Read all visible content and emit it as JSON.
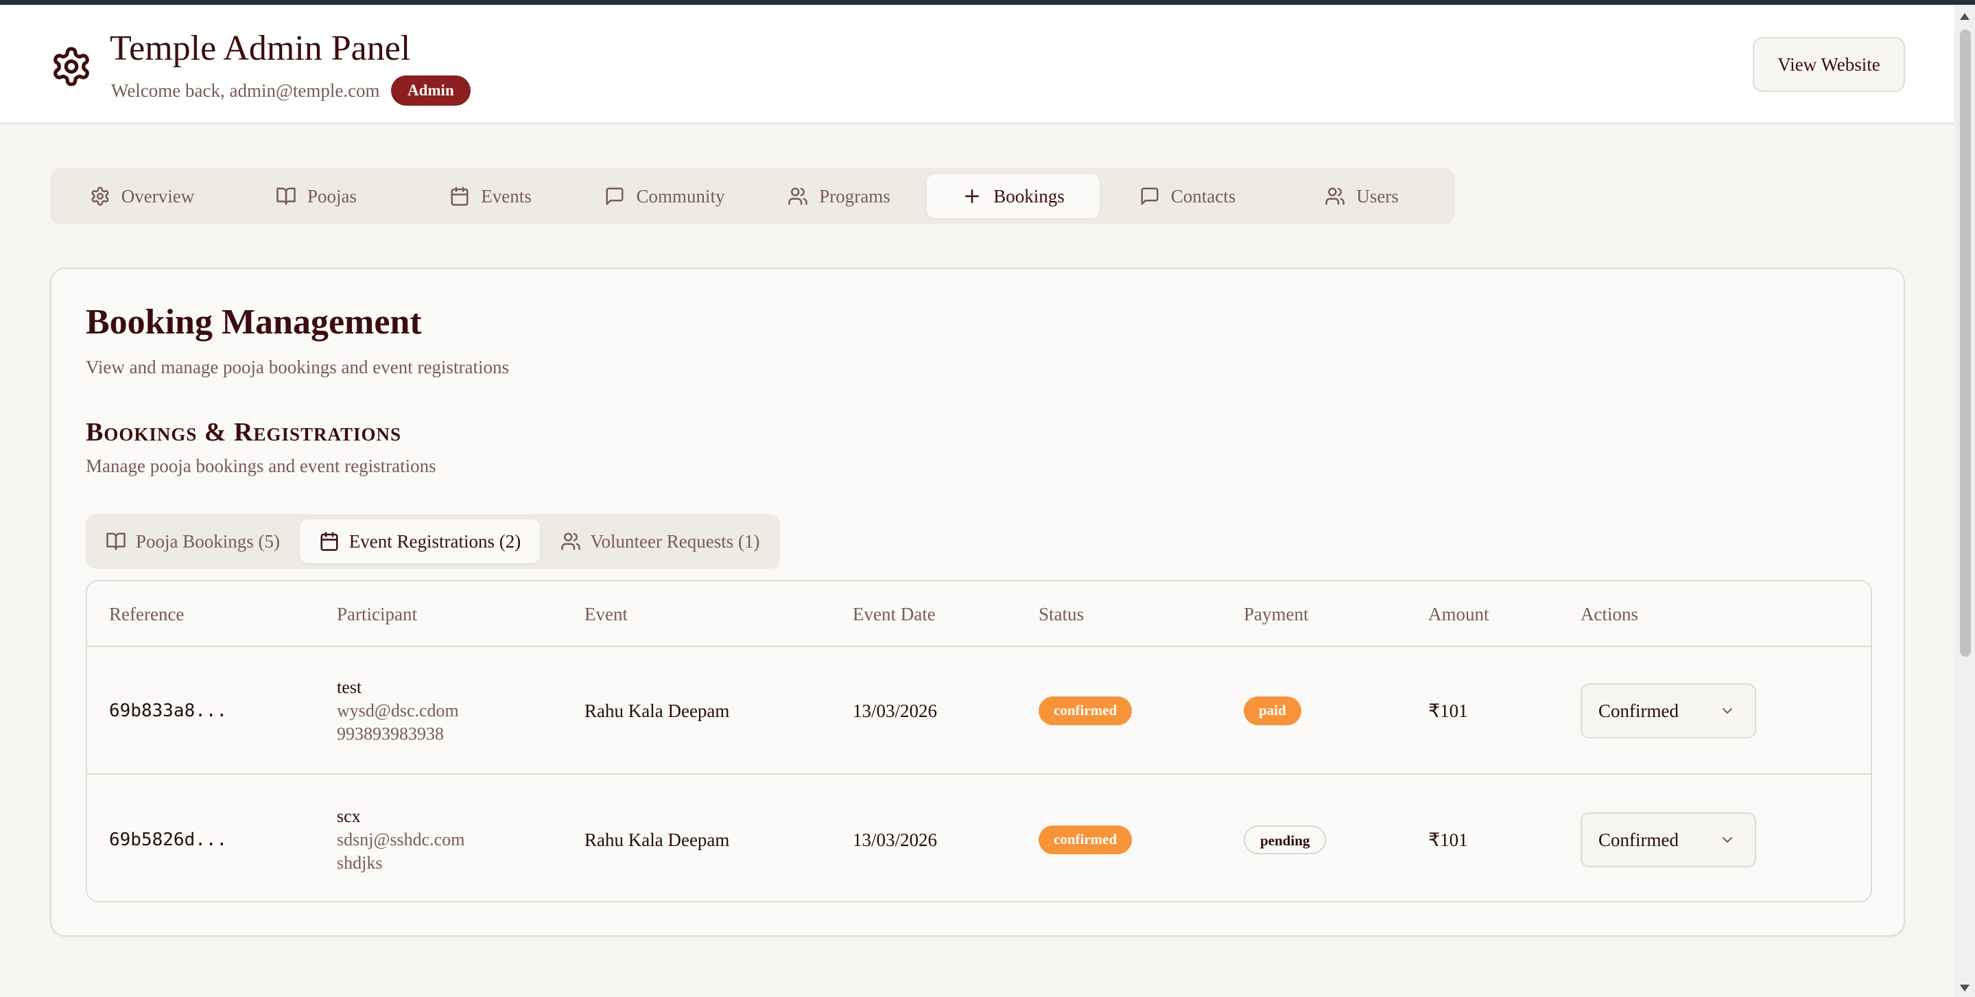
{
  "header": {
    "title": "Temple Admin Panel",
    "welcome": "Welcome back, admin@temple.com",
    "role_badge": "Admin",
    "view_website": "View Website"
  },
  "nav": {
    "tabs": [
      {
        "label": "Overview",
        "icon": "gear-icon"
      },
      {
        "label": "Poojas",
        "icon": "book-icon"
      },
      {
        "label": "Events",
        "icon": "calendar-icon"
      },
      {
        "label": "Community",
        "icon": "message-icon"
      },
      {
        "label": "Programs",
        "icon": "users-icon"
      },
      {
        "label": "Bookings",
        "icon": "plus-icon",
        "active": true
      },
      {
        "label": "Contacts",
        "icon": "message-icon"
      },
      {
        "label": "Users",
        "icon": "users-icon"
      }
    ]
  },
  "main": {
    "title": "Booking Management",
    "subtitle": "View and manage pooja bookings and event registrations",
    "section_title": "Bookings & Registrations",
    "section_subtitle": "Manage pooja bookings and event registrations",
    "subtabs": [
      {
        "label": "Pooja Bookings (5)",
        "icon": "book-icon"
      },
      {
        "label": "Event Registrations (2)",
        "icon": "calendar-icon",
        "active": true
      },
      {
        "label": "Volunteer Requests (1)",
        "icon": "users-icon"
      }
    ],
    "table": {
      "columns": [
        "Reference",
        "Participant",
        "Event",
        "Event Date",
        "Status",
        "Payment",
        "Amount",
        "Actions"
      ],
      "rows": [
        {
          "reference": "69b833a8...",
          "participant_name": "test",
          "participant_email": "wysd@dsc.cdom",
          "participant_phone": "993893983938",
          "event": "Rahu Kala Deepam",
          "event_date": "13/03/2026",
          "status": "confirmed",
          "payment": "paid",
          "amount": "₹101",
          "action_value": "Confirmed"
        },
        {
          "reference": "69b5826d...",
          "participant_name": "scx",
          "participant_email": "sdsnj@sshdc.com",
          "participant_phone": "shdjks",
          "event": "Rahu Kala Deepam",
          "event_date": "13/03/2026",
          "status": "confirmed",
          "payment": "pending",
          "amount": "₹101",
          "action_value": "Confirmed"
        }
      ]
    }
  },
  "colors": {
    "primary": "#3b0d0d",
    "muted_text": "#7a5a55",
    "admin_badge": "#8b1e1e",
    "status_orange": "#f7943a",
    "background": "#f7f6f3"
  }
}
